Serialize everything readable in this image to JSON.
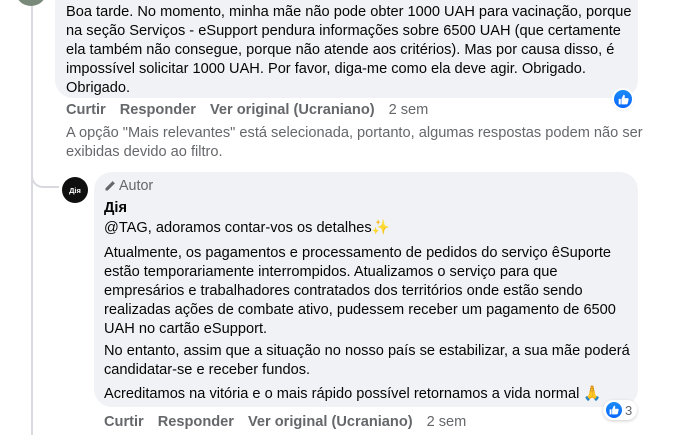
{
  "comment1": {
    "text": "Boa tarde. No momento, minha mãe não pode obter 1000 UAH para vacinação, porque na seção Serviços - eSupport pendura informações sobre 6500 UAH (que certamente ela também não consegue, porque não atende aos critérios). Mas por causa disso, é impossível solicitar 1000 UAH. Por favor, diga-me como ela deve agir. Obrigado. Obrigado.",
    "actions": {
      "like": "Curtir",
      "reply": "Responder",
      "see_original": "Ver original (Ucraniano)",
      "time": "2 sem"
    }
  },
  "filter_note": "A opção \"Mais relevantes\" está selecionada, portanto, algumas respostas podem não ser exibidas devido ao filtro.",
  "reply": {
    "avatar_text": "Дія",
    "badge": "Autor",
    "author": "Дія",
    "greeting": "@TAG, adoramos contar-vos os detalhes",
    "greeting_emoji": "✨",
    "para1": "Atualmente, os pagamentos e processamento de pedidos do serviço êSuporte estão temporariamente interrompidos. Atualizamos o serviço para que empresários e trabalhadores contratados dos territórios onde estão sendo realizadas ações de combate ativo, pudessem receber um pagamento de 6500 UAH no cartão eSupport.",
    "para2": "No entanto, assim que a situação no nosso país se estabilizar, a sua mãe poderá candidatar-se e receber fundos.",
    "para3": "Acreditamos na vitória e o mais rápido possível retornamos a vida normal",
    "para3_emoji": "🙏",
    "reaction_count": "3",
    "actions": {
      "like": "Curtir",
      "reply": "Responder",
      "see_original": "Ver original (Ucraniano)",
      "time": "2 sem"
    }
  },
  "colors": {
    "bubble": "#f0f2f5",
    "secondary_text": "#65676b",
    "like_blue": "#0866ff"
  }
}
